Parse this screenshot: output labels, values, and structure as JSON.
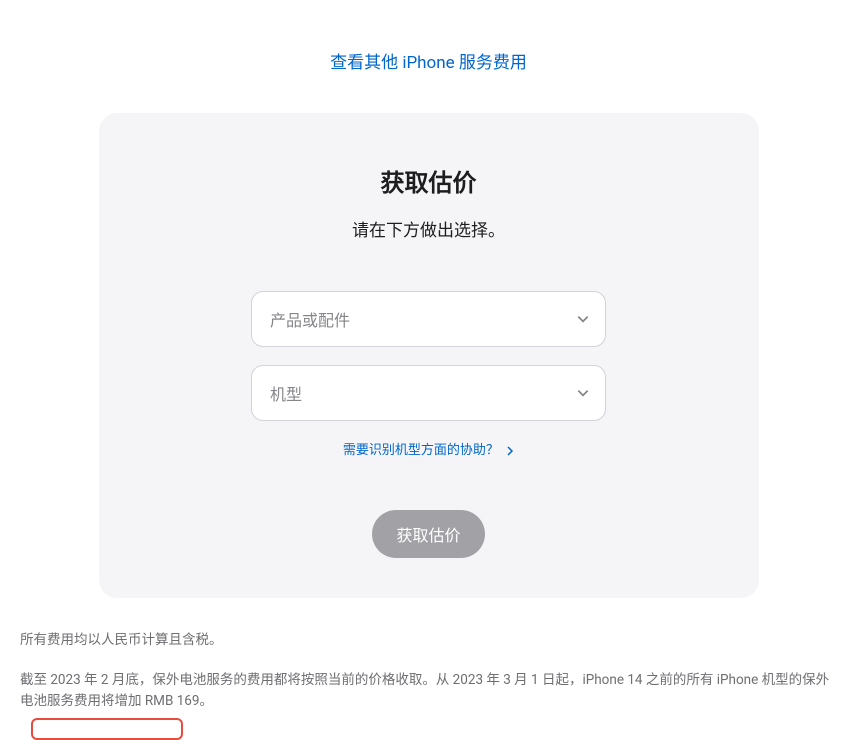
{
  "topLink": {
    "label": "查看其他 iPhone 服务费用"
  },
  "card": {
    "title": "获取估价",
    "subtitle": "请在下方做出选择。",
    "select1": {
      "placeholder": "产品或配件"
    },
    "select2": {
      "placeholder": "机型"
    },
    "helpLink": "需要识别机型方面的协助？",
    "submit": "获取估价"
  },
  "footer": {
    "line1": "所有费用均以人民币计算且含税。",
    "line2": "截至 2023 年 2 月底，保外电池服务的费用都将按照当前的价格收取。从 2023 年 3 月 1 日起，iPhone 14 之前的所有 iPhone 机型的保外电池服务费用将增加 RMB 169。"
  }
}
